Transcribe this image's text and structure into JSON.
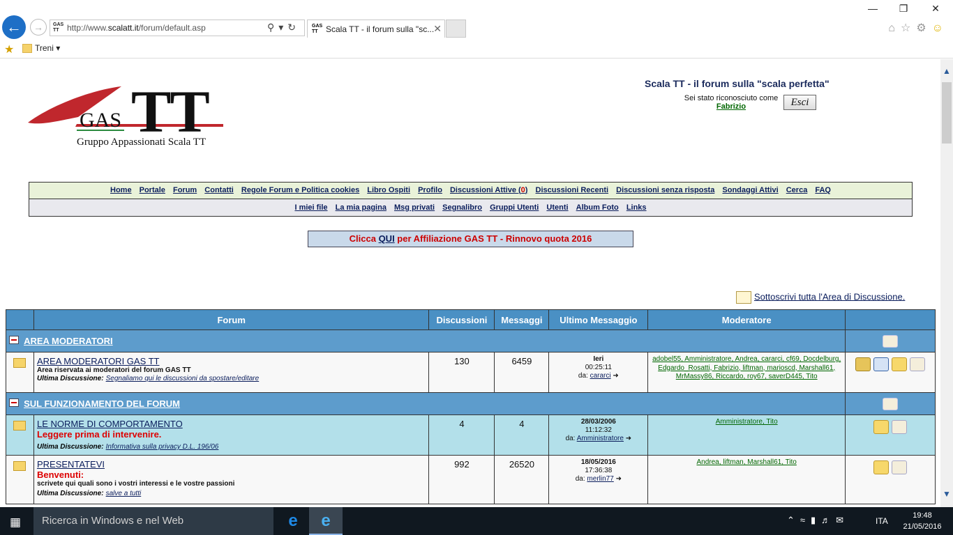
{
  "browser": {
    "url_prefix": "http://www.",
    "url_domain": "scalatt.it",
    "url_path": "/forum/default.asp",
    "tab_title": "Scala TT - il forum sulla \"sc...",
    "favbar_folder": "Treni"
  },
  "header": {
    "logo_big": "TT",
    "logo_gas": "GAS",
    "logo_sub": "Gruppo Appassionati Scala TT",
    "forum_title": "Scala TT - il forum sulla \"scala perfetta\"",
    "recognized_text": "Sei stato riconosciuto come",
    "username": "Fabrizio",
    "logout_label": "Esci"
  },
  "menu1": [
    "Home",
    "Portale",
    "Forum",
    "Contatti",
    "Regole Forum e Politica cookies",
    "Libro Ospiti",
    "Profilo",
    "Discussioni Attive (",
    "0",
    ")",
    "Discussioni Recenti",
    "Discussioni senza risposta",
    "Sondaggi Attivi",
    "Cerca",
    "FAQ"
  ],
  "menu2": [
    "I miei file",
    "La mia pagina",
    "Msg privati",
    "Segnalibro",
    "Gruppi Utenti",
    "Utenti",
    "Album Foto",
    "Links"
  ],
  "affiliation": {
    "pre": "Clicca ",
    "link": "QUI",
    "post": " per Affiliazione GAS TT - Rinnovo quota 2016"
  },
  "subscribe_all": "Sottoscrivi tutta l'Area di Discussione.",
  "table": {
    "headers": [
      "Forum",
      "Discussioni",
      "Messaggi",
      "Ultimo Messaggio",
      "Moderatore"
    ],
    "cat1": "AREA MODERATORI",
    "cat2": "SUL FUNZIONAMENTO DEL FORUM",
    "r1": {
      "name": "AREA MODERATORI GAS TT",
      "desc": "Area riservata ai moderatori del forum GAS TT",
      "last_label": "Ultima Discussione:",
      "last_topic": "Segnaliamo qui le discussioni da spostare/editare",
      "topics": "130",
      "posts": "6459",
      "last_date": "Ieri",
      "last_time": "00:25:11",
      "by_label": "da:",
      "last_user": "cararci",
      "mods": "adobel55, Amministratore, Andrea, cararci, cf69, Docdelburg, Edgardo_Rosatti, Fabrizio, liftman, marioscd, Marshall61, MrMassy86, Riccardo, roy67, saverD445, Tito"
    },
    "r2": {
      "name": "LE NORME DI COMPORTAMENTO",
      "desc": "Leggere prima di intervenire.",
      "last_label": "Ultima Discussione:",
      "last_topic": "Informativa sulla privacy D.L. 196/06",
      "topics": "4",
      "posts": "4",
      "last_date": "28/03/2006",
      "last_time": "11:12:32",
      "by_label": "da:",
      "last_user": "Amministratore",
      "mods": "Amministratore, Tito"
    },
    "r3": {
      "name": "PRESENTATEVI",
      "desc": "Benvenuti:",
      "desc2": "scrivete qui quali sono i vostri interessi e le vostre passioni",
      "last_label": "Ultima Discussione:",
      "last_topic": "salve a tutti",
      "topics": "992",
      "posts": "26520",
      "last_date": "18/05/2016",
      "last_time": "17:36:38",
      "by_label": "da:",
      "last_user": "merlin77",
      "mods": "Andrea, liftman, Marshall61, Tito"
    }
  },
  "taskbar": {
    "search_placeholder": "Ricerca in Windows e nel Web",
    "lang": "ITA",
    "time": "19:48",
    "date": "21/05/2016"
  }
}
